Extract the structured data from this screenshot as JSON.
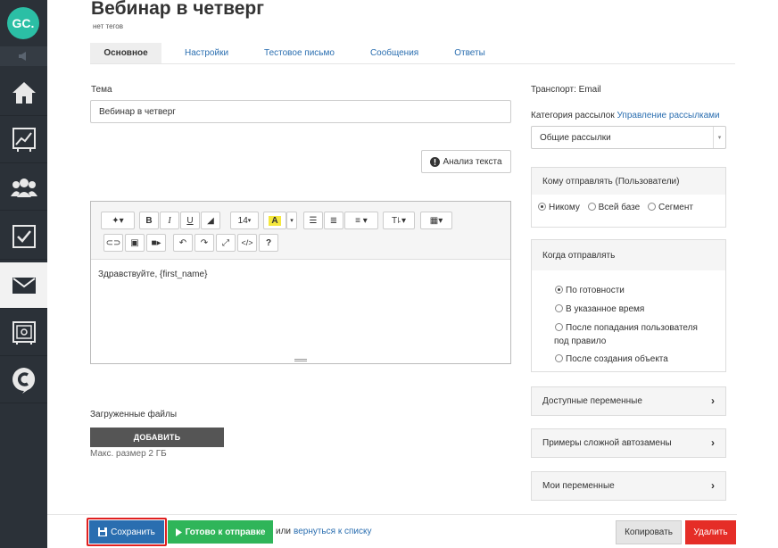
{
  "sidebar": {
    "logo_text": "GC.",
    "items": [
      {
        "icon": "home-icon"
      },
      {
        "icon": "chart-icon"
      },
      {
        "icon": "users-icon"
      },
      {
        "icon": "tasks-icon"
      },
      {
        "icon": "mail-icon",
        "active": true
      },
      {
        "icon": "safe-icon"
      },
      {
        "icon": "chat-icon"
      }
    ]
  },
  "header": {
    "title": "Вебинар в четверг",
    "tags": "нет тегов"
  },
  "tabs": [
    {
      "label": "Основное",
      "active": true
    },
    {
      "label": "Настройки"
    },
    {
      "label": "Тестовое письмо"
    },
    {
      "label": "Сообщения"
    },
    {
      "label": "Ответы"
    }
  ],
  "form": {
    "subject_label": "Тема",
    "subject_value": "Вебинар в четверг",
    "analyze_button": "Анализ текста",
    "editor_font_size": "14",
    "editor_content": "Здравствуйте, {first_name}",
    "files_label": "Загруженные файлы",
    "add_button": "ДОБАВИТЬ",
    "max_size": "Макс. размер 2 ГБ"
  },
  "right": {
    "transport": "Транспорт: Email",
    "category_label": "Категория рассылок",
    "category_link": "Управление рассылками",
    "category_value": "Общие рассылки",
    "recipients": {
      "title": "Кому отправлять (Пользователи)",
      "options": [
        {
          "label": "Никому",
          "selected": true
        },
        {
          "label": "Всей базе",
          "selected": false
        },
        {
          "label": "Сегмент",
          "selected": false
        }
      ]
    },
    "when": {
      "title": "Когда отправлять",
      "options": [
        {
          "label": "По готовности",
          "selected": true
        },
        {
          "label": "В указанное время",
          "selected": false
        },
        {
          "label": "После попадания пользователя",
          "label2": "под правило",
          "selected": false
        },
        {
          "label": "После создания объекта",
          "selected": false
        }
      ]
    },
    "sections": [
      {
        "label": "Доступные переменные"
      },
      {
        "label": "Примеры сложной автозамены"
      },
      {
        "label": "Мои переменные"
      }
    ]
  },
  "footer": {
    "save": "Сохранить",
    "ready": "Готово к отправке",
    "or": "или",
    "back": "вернуться к списку",
    "copy": "Копировать",
    "delete": "Удалить"
  },
  "colors": {
    "sidebar_bg": "#2b3138",
    "brand": "#2bbfa5",
    "link": "#2a6eb0",
    "save": "#2a6eb0",
    "ready": "#2fb559",
    "delete": "#e52d27"
  }
}
